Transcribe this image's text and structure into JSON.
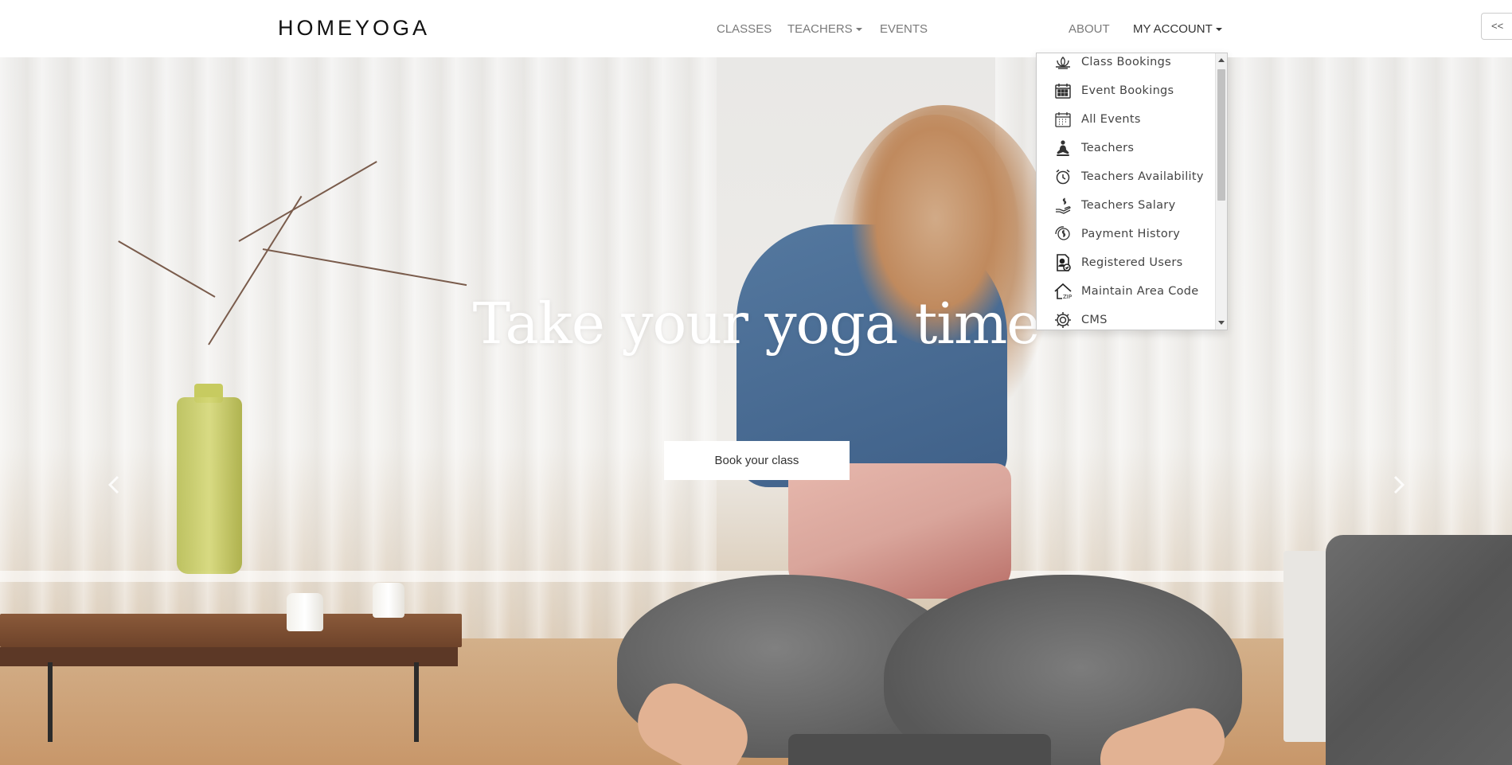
{
  "brand": {
    "logo": "HOMEYOGA"
  },
  "nav": {
    "classes": "CLASSES",
    "teachers": "TEACHERS",
    "events": "EVENTS",
    "about": "ABOUT",
    "my_account": "MY ACCOUNT"
  },
  "collapse_button": "<<",
  "hero": {
    "title": "Take your yoga time",
    "button": "Book your class"
  },
  "account_menu": {
    "items": [
      {
        "label": "Class Bookings",
        "icon": "lotus-icon"
      },
      {
        "label": "Event Bookings",
        "icon": "calendar-icon"
      },
      {
        "label": "All Events",
        "icon": "calendar-grid-icon"
      },
      {
        "label": "Teachers",
        "icon": "meditation-icon"
      },
      {
        "label": "Teachers Availability",
        "icon": "alarm-clock-icon"
      },
      {
        "label": "Teachers Salary",
        "icon": "hand-dollar-icon"
      },
      {
        "label": "Payment History",
        "icon": "dollar-history-icon"
      },
      {
        "label": "Registered Users",
        "icon": "user-document-icon"
      },
      {
        "label": "Maintain Area Code",
        "icon": "house-zip-icon"
      },
      {
        "label": "CMS",
        "icon": "gear-icon"
      }
    ],
    "scroll_position": 0
  },
  "colors": {
    "nav_text": "#7a7a7a",
    "nav_text_active": "#333333",
    "hero_text": "#ffffff"
  }
}
